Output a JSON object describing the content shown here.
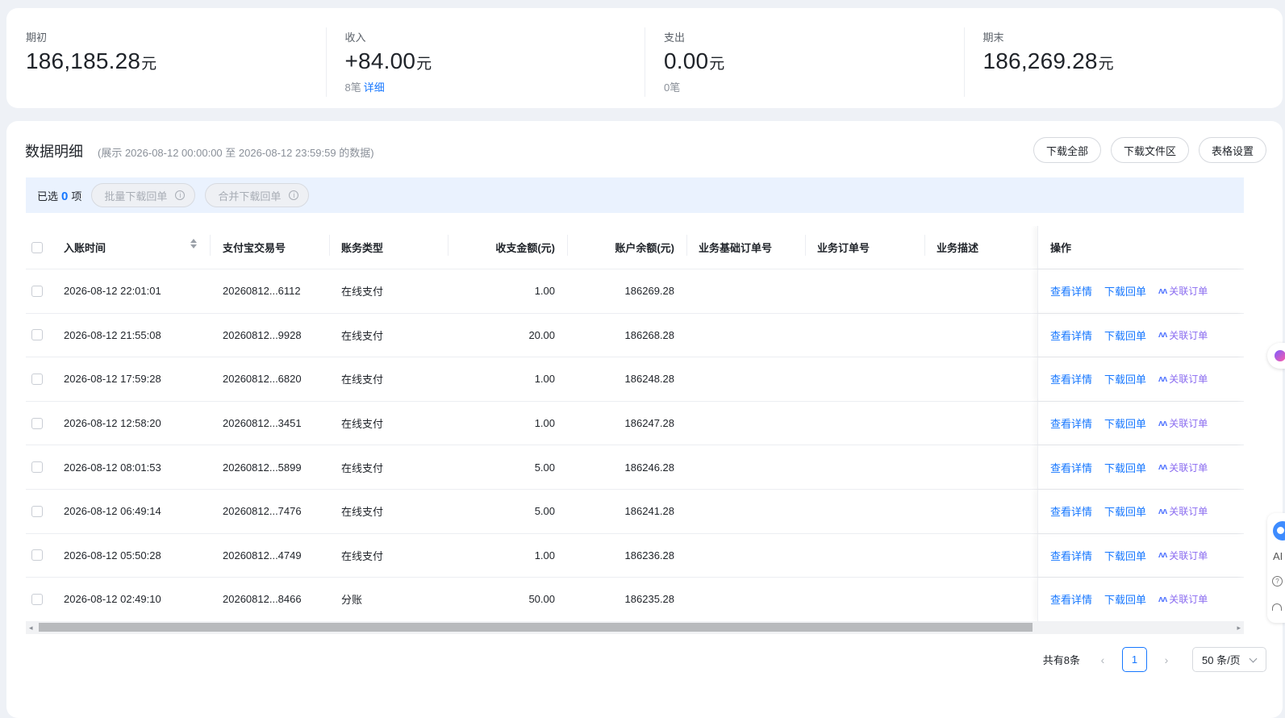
{
  "summary": {
    "opening": {
      "label": "期初",
      "value": "186,185.28",
      "unit": "元"
    },
    "income": {
      "label": "收入",
      "value": "+84.00",
      "unit": "元",
      "count": "8笔",
      "link": "详细"
    },
    "expense": {
      "label": "支出",
      "value": "0.00",
      "unit": "元",
      "count": "0笔"
    },
    "closing": {
      "label": "期末",
      "value": "186,269.28",
      "unit": "元"
    }
  },
  "detail": {
    "title": "数据明细",
    "range": "(展示 2026-08-12 00:00:00 至 2026-08-12 23:59:59 的数据)",
    "buttons": {
      "download_all": "下载全部",
      "download_files": "下载文件区",
      "table_settings": "表格设置"
    }
  },
  "selection": {
    "prefix": "已选",
    "count": "0",
    "suffix": "项",
    "batch_download": "批量下载回单",
    "merge_download": "合并下载回单"
  },
  "table": {
    "headers": {
      "time": "入账时间",
      "alipay_no": "支付宝交易号",
      "type": "账务类型",
      "amount": "收支金额(元)",
      "balance": "账户余额(元)",
      "base_order": "业务基础订单号",
      "order": "业务订单号",
      "desc": "业务描述",
      "op": "操作"
    },
    "actions": {
      "view": "查看详情",
      "receipt": "下载回单",
      "ai_mark": "ʌʌ",
      "link_order": "关联订单"
    },
    "rows": [
      {
        "time": "2026-08-12 22:01:01",
        "alipay_no": "20260812...6112",
        "type": "在线支付",
        "amount": "1.00",
        "balance": "186269.28"
      },
      {
        "time": "2026-08-12 21:55:08",
        "alipay_no": "20260812...9928",
        "type": "在线支付",
        "amount": "20.00",
        "balance": "186268.28"
      },
      {
        "time": "2026-08-12 17:59:28",
        "alipay_no": "20260812...6820",
        "type": "在线支付",
        "amount": "1.00",
        "balance": "186248.28"
      },
      {
        "time": "2026-08-12 12:58:20",
        "alipay_no": "20260812...3451",
        "type": "在线支付",
        "amount": "1.00",
        "balance": "186247.28"
      },
      {
        "time": "2026-08-12 08:01:53",
        "alipay_no": "20260812...5899",
        "type": "在线支付",
        "amount": "5.00",
        "balance": "186246.28"
      },
      {
        "time": "2026-08-12 06:49:14",
        "alipay_no": "20260812...7476",
        "type": "在线支付",
        "amount": "5.00",
        "balance": "186241.28"
      },
      {
        "time": "2026-08-12 05:50:28",
        "alipay_no": "20260812...4749",
        "type": "在线支付",
        "amount": "1.00",
        "balance": "186236.28"
      },
      {
        "time": "2026-08-12 02:49:10",
        "alipay_no": "20260812...8466",
        "type": "分账",
        "amount": "50.00",
        "balance": "186235.28"
      }
    ]
  },
  "pagination": {
    "total": "共有8条",
    "prev": "‹",
    "current": "1",
    "next": "›",
    "page_size": "50 条/页"
  },
  "float": {
    "ai": "AI"
  },
  "colors": {
    "accent": "#1677ff",
    "ai_purple": "#8b6cf0",
    "select_bar": "#eaf2fe"
  }
}
